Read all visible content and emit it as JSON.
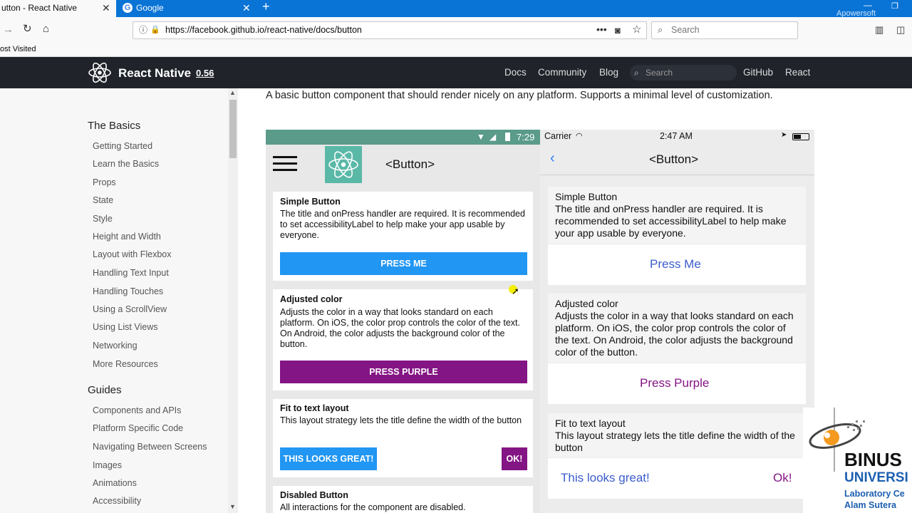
{
  "browser": {
    "tabs": [
      {
        "label": "utton - React Native",
        "active": true
      },
      {
        "label": "Google",
        "active": false
      }
    ],
    "url": "https://facebook.github.io/react-native/docs/button",
    "search_placeholder": "Search",
    "bookmarks_label": "ost Visited",
    "watermark": "Apowersoft"
  },
  "site": {
    "brand": "React Native",
    "version": "0.56",
    "nav": [
      "Docs",
      "Community",
      "Blog",
      "GitHub",
      "React"
    ],
    "search_placeholder": "Search"
  },
  "sidebar": {
    "sections": [
      {
        "title": "The Basics",
        "items": [
          "Getting Started",
          "Learn the Basics",
          "Props",
          "State",
          "Style",
          "Height and Width",
          "Layout with Flexbox",
          "Handling Text Input",
          "Handling Touches",
          "Using a ScrollView",
          "Using List Views",
          "Networking",
          "More Resources"
        ]
      },
      {
        "title": "Guides",
        "items": [
          "Components and APIs",
          "Platform Specific Code",
          "Navigating Between Screens",
          "Images",
          "Animations",
          "Accessibility"
        ]
      }
    ]
  },
  "main": {
    "intro": "A basic button component that should render nicely on any platform. Supports a minimal level of customization."
  },
  "android": {
    "time": "7:29",
    "title": "<Button>",
    "cards": [
      {
        "title": "Simple Button",
        "desc": "The title and onPress handler are required. It is recommended to set accessibilityLabel to help make your app usable by everyone.",
        "button": "PRESS ME"
      },
      {
        "title": "Adjusted color",
        "desc": "Adjusts the color in a way that looks standard on each platform. On iOS, the color prop controls the color of the text. On Android, the color adjusts the background color of the button.",
        "button": "PRESS PURPLE"
      },
      {
        "title": "Fit to text layout",
        "desc": "This layout strategy lets the title define the width of the button",
        "button": "THIS LOOKS GREAT!",
        "button2": "OK!"
      },
      {
        "title": "Disabled Button",
        "desc": "All interactions for the component are disabled."
      }
    ]
  },
  "ios": {
    "carrier": "Carrier",
    "time": "2:47 AM",
    "title": "<Button>",
    "cards": [
      {
        "title": "Simple Button",
        "desc": "The title and onPress handler are required. It is recommended to set accessibilityLabel to help make your app usable by everyone.",
        "button": "Press Me"
      },
      {
        "title": "Adjusted color",
        "desc": "Adjusts the color in a way that looks standard on each platform. On iOS, the color prop controls the color of the text. On Android, the color adjusts the background color of the button.",
        "button": "Press Purple"
      },
      {
        "title": "Fit to text layout",
        "desc": "This layout strategy lets the title define the width of the button",
        "button": "This looks great!",
        "button2": "Ok!"
      }
    ]
  },
  "overlay": {
    "name": "BINUS",
    "line2": "UNIVERSI",
    "line3": "Laboratory Ce",
    "line4": "Alam Sutera"
  },
  "colors": {
    "tabbar": "#0a74d6",
    "header": "#20232a",
    "android_blue": "#2196f3",
    "purple": "#841584",
    "ios_blue": "#3a5ccc",
    "android_status": "#5a9b8a"
  }
}
